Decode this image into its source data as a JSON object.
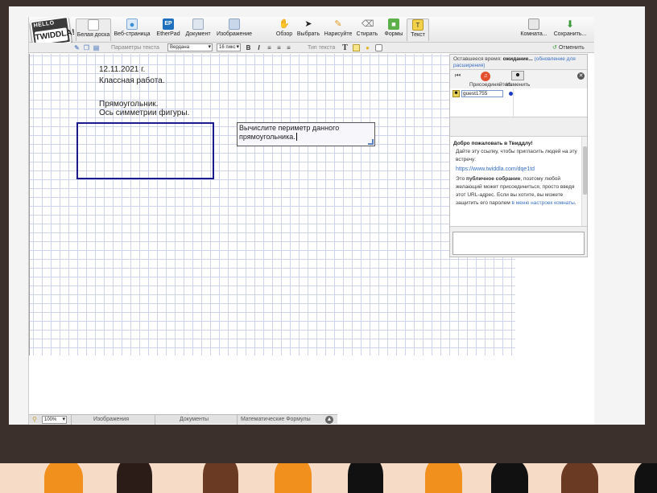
{
  "toolbar": {
    "logo_top": "HELLO",
    "logo_name": "TWIDDLA!",
    "tools": [
      {
        "label": "Белая доска",
        "icon": "whiteboard-icon",
        "color": "#ffffff"
      },
      {
        "label": "Веб-страница",
        "icon": "web-page-icon",
        "color": "#3b8fd6"
      },
      {
        "label": "EtherPad",
        "icon": "etherpad-icon",
        "color": "#1f6fbf"
      },
      {
        "label": "Документ",
        "icon": "document-icon",
        "color": "#dfe6f0"
      },
      {
        "label": "Изображение",
        "icon": "image-icon",
        "color": "#c9d7ea"
      },
      {
        "label": "Обзор",
        "icon": "hand-icon",
        "color": "#eeeeee"
      },
      {
        "label": "Выбрать",
        "icon": "cursor-icon",
        "color": "#eeeeee"
      },
      {
        "label": "Нарисуйте",
        "icon": "pencil-icon",
        "color": "#f2b33d"
      },
      {
        "label": "Стирать",
        "icon": "eraser-icon",
        "color": "#dddddd"
      },
      {
        "label": "Формы",
        "icon": "shapes-icon",
        "color": "#5bb04a"
      },
      {
        "label": "Текст",
        "icon": "text-icon",
        "color": "#f3d24a"
      }
    ],
    "room_label": "Комната...",
    "save_label": "Сохранить..."
  },
  "toolbar2": {
    "params_label": "Параметры текста",
    "font": "Вердана",
    "size": "16 пикс",
    "bold": "B",
    "italic": "I",
    "text_type_label": "Тип текста",
    "text_tool_glyph": "T",
    "undo_label": "Отменить"
  },
  "canvas": {
    "date": "12.11.2021 г.",
    "classwork": "Классная работа.",
    "rect_title": "Прямоугольник.",
    "symmetry": "Ось симметрии фигуры.",
    "task": "Вычислите периметр данного прямоугольника."
  },
  "panel": {
    "time_label": "Оставшееся время:",
    "time_value": "ожидание...",
    "upgrade_link": "(обновление для расширения)",
    "join_label": "Присоединяйтесь",
    "change_label": "Изменить",
    "guest_name": "guest1755",
    "welcome_title": "Добро пожаловать в Твиддлу!",
    "welcome_line": "Дайте эту ссылку, чтобы пригласить людей на эту встречу:",
    "meeting_url": "https://www.twiddla.com/dqe1td",
    "public_prefix": "Это",
    "public_bold": "публичное собрание",
    "public_text": ", поэтому любой желающий может присоединиться, просто введя этот URL-адрес. Если вы хотите, вы можете защитить его паролем",
    "settings_link": "в меню настроек комнаты",
    "period": "."
  },
  "statusbar": {
    "zoom": "100%",
    "images": "Изображения",
    "documents": "Документы",
    "formulas": "Математические Формулы"
  },
  "colors": {
    "frame_background": "#3b302c",
    "crowd_background": "#f6dbc6",
    "rectangle_stroke": "#1b1b8d",
    "grid_line": "#cfd3ee",
    "link": "#3a6fbf"
  }
}
